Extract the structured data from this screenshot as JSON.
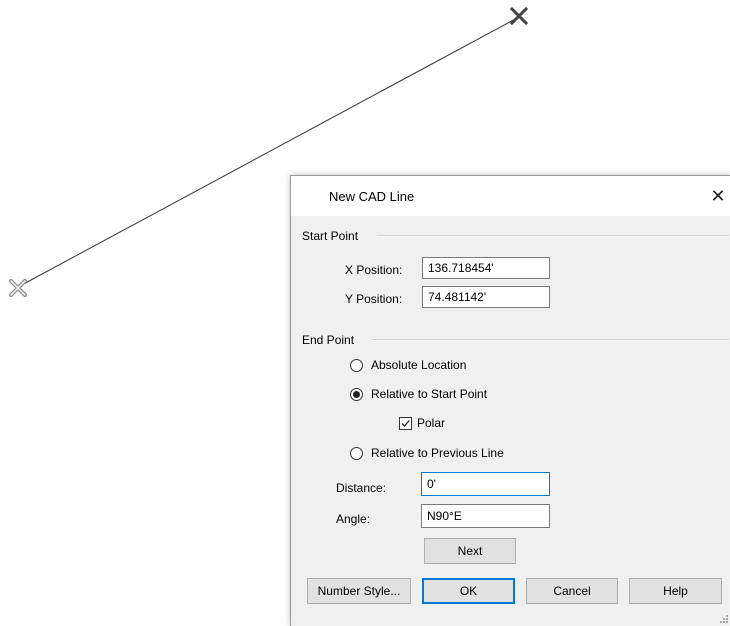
{
  "dialog": {
    "title": "New CAD Line",
    "close_icon": "close-icon",
    "start_point": {
      "group_label": "Start Point",
      "x_label": "X Position:",
      "x_value": "136.718454'",
      "y_label": "Y Position:",
      "y_value": "74.481142'"
    },
    "end_point": {
      "group_label": "End Point",
      "options": {
        "absolute": "Absolute Location",
        "relative_start": "Relative to Start Point",
        "relative_previous": "Relative to Previous Line"
      },
      "selected": "relative_start",
      "polar_label": "Polar",
      "polar_checked": true,
      "distance_label": "Distance:",
      "distance_value": "0'",
      "angle_label": "Angle:",
      "angle_value": "N90°E",
      "next_label": "Next"
    },
    "buttons": {
      "number_style": "Number Style...",
      "ok": "OK",
      "cancel": "Cancel",
      "help": "Help"
    }
  },
  "canvas": {
    "start_marker_icon": "x-marker-icon",
    "end_marker_icon": "x-marker-icon",
    "line_color": "#333333"
  }
}
